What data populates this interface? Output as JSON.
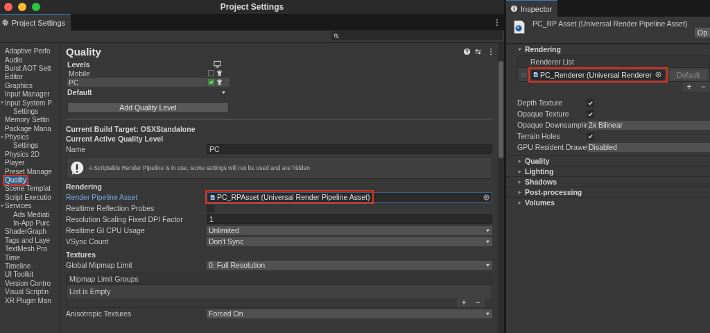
{
  "window": {
    "title": "Project Settings",
    "tab": "Project Settings"
  },
  "sidebar": {
    "items": [
      {
        "label": "Adaptive Perfo",
        "selected": false
      },
      {
        "label": "Audio",
        "selected": false
      },
      {
        "label": "Burst AOT Sett",
        "selected": false
      },
      {
        "label": "Editor",
        "selected": false
      },
      {
        "label": "Graphics",
        "selected": false
      },
      {
        "label": "Input Manager",
        "selected": false
      },
      {
        "label": "Input System P",
        "selected": false,
        "children": [
          {
            "label": "Settings",
            "selected": false
          }
        ]
      },
      {
        "label": "Memory Settin",
        "selected": false
      },
      {
        "label": "Package Mana",
        "selected": false
      },
      {
        "label": "Physics",
        "selected": false,
        "children": [
          {
            "label": "Settings",
            "selected": false
          }
        ]
      },
      {
        "label": "Physics 2D",
        "selected": false
      },
      {
        "label": "Player",
        "selected": false
      },
      {
        "label": "Preset Manage",
        "selected": false
      },
      {
        "label": "Quality",
        "selected": true
      },
      {
        "label": "Scene Templat",
        "selected": false
      },
      {
        "label": "Script Executio",
        "selected": false
      },
      {
        "label": "Services",
        "selected": false,
        "children": [
          {
            "label": "Ads Mediati",
            "selected": false
          },
          {
            "label": "In-App Purc",
            "selected": false
          }
        ]
      },
      {
        "label": "ShaderGraph",
        "selected": false
      },
      {
        "label": "Tags and Laye",
        "selected": false
      },
      {
        "label": "TextMesh Pro",
        "selected": false
      },
      {
        "label": "Time",
        "selected": false
      },
      {
        "label": "Timeline",
        "selected": false
      },
      {
        "label": "UI Toolkit",
        "selected": false
      },
      {
        "label": "Version Contro",
        "selected": false
      },
      {
        "label": "Visual Scriptin",
        "selected": false
      },
      {
        "label": "XR Plugin Man",
        "selected": false
      }
    ]
  },
  "quality": {
    "title": "Quality",
    "levels": {
      "label": "Levels",
      "items": [
        {
          "name": "Mobile",
          "checked": false,
          "selected": false
        },
        {
          "name": "PC",
          "checked": true,
          "selected": true
        }
      ],
      "default_label": "Default",
      "add_button": "Add Quality Level"
    },
    "build_target": "Current Build Target: OSXStandalone",
    "active_level_heading": "Current Active Quality Level",
    "name_field": {
      "label": "Name",
      "value": "PC"
    },
    "help": "A Scriptable Render Pipeline is in use, some settings will not be used and are hidden",
    "sections": [
      {
        "title": "Rendering",
        "properties": [
          {
            "kind": "object",
            "label": "Render Pipeline Asset",
            "value": "PC_RPAsset (Universal Render Pipeline Asset)",
            "focused": true,
            "annotated": true
          },
          {
            "kind": "checkbox",
            "label": "Realtime Reflection Probes",
            "checked": false
          },
          {
            "kind": "number",
            "label": "Resolution Scaling Fixed DPI Factor",
            "value": "1"
          },
          {
            "kind": "dropdown",
            "label": "Realtime GI CPU Usage",
            "value": "Unlimited"
          },
          {
            "kind": "dropdown",
            "label": "VSync Count",
            "value": "Don't Sync"
          }
        ]
      },
      {
        "title": "Textures",
        "properties": [
          {
            "kind": "dropdown",
            "label": "Global Mipmap Limit",
            "value": "0: Full Resolution"
          },
          {
            "kind": "list",
            "label": "Mipmap Limit Groups",
            "value": "List is Empty",
            "add_button": "+",
            "remove_button": "−"
          },
          {
            "kind": "dropdown",
            "label": "Anisotropic Textures",
            "value": "Forced On"
          }
        ]
      }
    ]
  },
  "inspector": {
    "tab": "Inspector",
    "asset_title": "PC_RP Asset (Universal Render Pipeline Asset)",
    "open_button": "Op",
    "sections": [
      {
        "title": "Rendering",
        "expanded": true,
        "renderer_list": {
          "label": "Renderer List",
          "items": [
            {
              "value": "PC_Renderer (Universal Renderer",
              "annotated": true,
              "default_button": "Default"
            }
          ],
          "add_button": "+",
          "remove_button": "−"
        },
        "properties": [
          {
            "kind": "checkbox",
            "label": "Depth Texture",
            "checked": true
          },
          {
            "kind": "checkbox",
            "label": "Opaque Texture",
            "checked": true
          },
          {
            "kind": "dropdown",
            "label": "Opaque Downsamplin",
            "value": "2x Bilinear"
          },
          {
            "kind": "checkbox",
            "label": "Terrain Holes",
            "checked": true
          },
          {
            "kind": "dropdown",
            "label": "GPU Resident Drawe",
            "value": "Disabled"
          }
        ]
      },
      {
        "title": "Quality",
        "expanded": false
      },
      {
        "title": "Lighting",
        "expanded": false
      },
      {
        "title": "Shadows",
        "expanded": false
      },
      {
        "title": "Post-processing",
        "expanded": false
      },
      {
        "title": "Volumes",
        "expanded": false
      }
    ]
  }
}
